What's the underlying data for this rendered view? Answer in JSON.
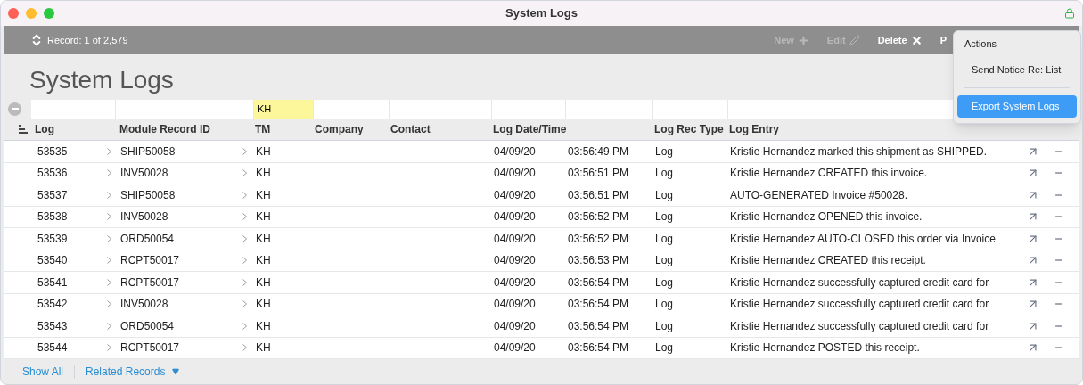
{
  "window": {
    "title": "System Logs"
  },
  "toolbar": {
    "record": "Record: 1 of 2,579",
    "buttons": [
      {
        "label": "New",
        "kind": "new",
        "disabled": true
      },
      {
        "label": "Edit",
        "kind": "edit",
        "disabled": true
      },
      {
        "label": "Delete",
        "kind": "delete",
        "disabled": false
      },
      {
        "label": "P",
        "kind": "plain",
        "disabled": false
      }
    ]
  },
  "page_title": "System Logs",
  "filters": [
    {
      "highlighted": false
    },
    {
      "highlighted": false
    },
    {
      "value": "KH",
      "highlighted": true
    },
    {
      "highlighted": false
    },
    {
      "highlighted": false
    },
    {
      "highlighted": false
    },
    {
      "highlighted": false
    },
    {
      "highlighted": false
    },
    {
      "highlighted": false
    }
  ],
  "table": {
    "columns": [
      "Log",
      "Module Record ID",
      "TM",
      "Company",
      "Contact",
      "Log Date/Time",
      "",
      "Log Rec Type",
      "Log Entry"
    ],
    "rows": [
      {
        "log": "53535",
        "module": "SHIP50058",
        "tm": "KH",
        "date": "04/09/20",
        "time": "03:56:49 PM",
        "type": "Log",
        "entry": "Kristie Hernandez marked this shipment as SHIPPED."
      },
      {
        "log": "53536",
        "module": "INV50028",
        "tm": "KH",
        "date": "04/09/20",
        "time": "03:56:51 PM",
        "type": "Log",
        "entry": "Kristie Hernandez CREATED this invoice."
      },
      {
        "log": "53537",
        "module": "SHIP50058",
        "tm": "KH",
        "date": "04/09/20",
        "time": "03:56:51 PM",
        "type": "Log",
        "entry": "AUTO-GENERATED Invoice #50028."
      },
      {
        "log": "53538",
        "module": "INV50028",
        "tm": "KH",
        "date": "04/09/20",
        "time": "03:56:52 PM",
        "type": "Log",
        "entry": "Kristie Hernandez OPENED this invoice."
      },
      {
        "log": "53539",
        "module": "ORD50054",
        "tm": "KH",
        "date": "04/09/20",
        "time": "03:56:52 PM",
        "type": "Log",
        "entry": "Kristie Hernandez AUTO-CLOSED this order via Invoice"
      },
      {
        "log": "53540",
        "module": "RCPT50017",
        "tm": "KH",
        "date": "04/09/20",
        "time": "03:56:53 PM",
        "type": "Log",
        "entry": "Kristie Hernandez CREATED this receipt."
      },
      {
        "log": "53541",
        "module": "RCPT50017",
        "tm": "KH",
        "date": "04/09/20",
        "time": "03:56:54 PM",
        "type": "Log",
        "entry": "Kristie Hernandez successfully captured credit card for"
      },
      {
        "log": "53542",
        "module": "INV50028",
        "tm": "KH",
        "date": "04/09/20",
        "time": "03:56:54 PM",
        "type": "Log",
        "entry": "Kristie Hernandez successfully captured credit card for"
      },
      {
        "log": "53543",
        "module": "ORD50054",
        "tm": "KH",
        "date": "04/09/20",
        "time": "03:56:54 PM",
        "type": "Log",
        "entry": "Kristie Hernandez successfully captured credit card for"
      },
      {
        "log": "53544",
        "module": "RCPT50017",
        "tm": "KH",
        "date": "04/09/20",
        "time": "03:56:54 PM",
        "type": "Log",
        "entry": "Kristie Hernandez POSTED this receipt."
      }
    ]
  },
  "menu": {
    "title": "Actions",
    "items": [
      {
        "label": "Send Notice Re: List",
        "selected": false
      },
      {
        "label": "Export System Logs",
        "selected": true
      }
    ]
  },
  "footer": {
    "links": [
      {
        "label": "Show All",
        "kind": "plain"
      },
      {
        "label": "Related Records",
        "kind": "dropdown"
      }
    ]
  }
}
